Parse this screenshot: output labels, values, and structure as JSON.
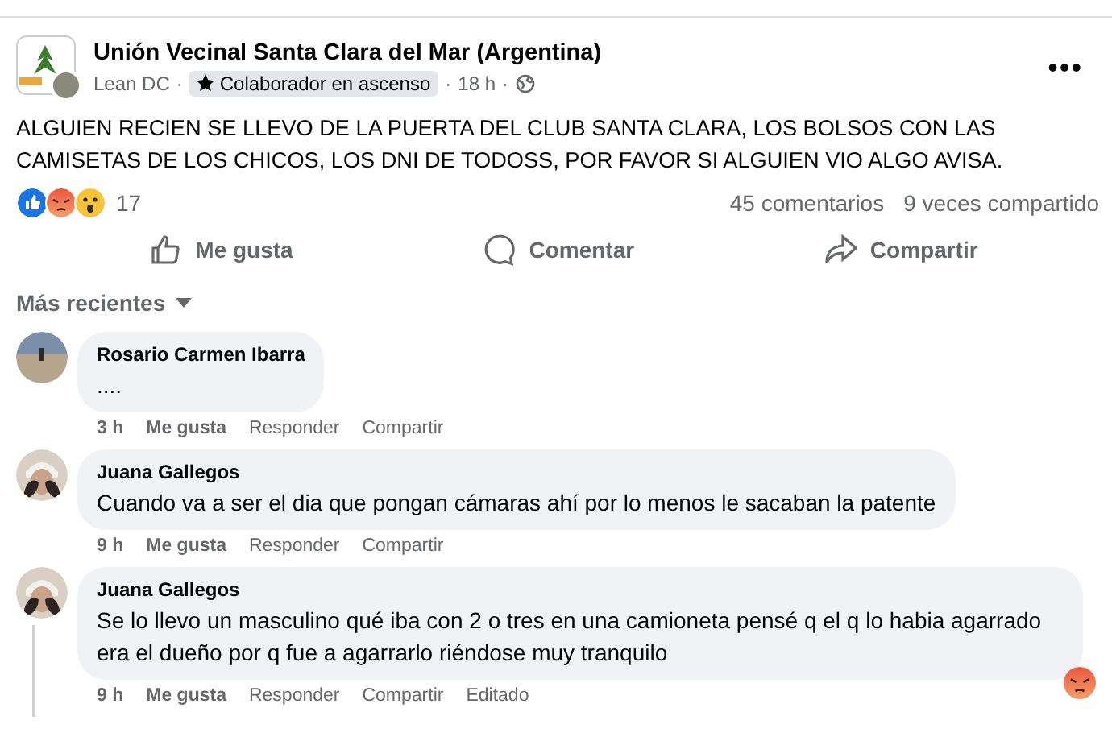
{
  "post": {
    "group": "Unión Vecinal Santa Clara del Mar (Argentina)",
    "author": "Lean DC",
    "separator": "·",
    "more": "•••",
    "badge": "Colaborador en ascenso",
    "time": "18 h",
    "text": "ALGUIEN RECIEN SE LLEVO DE LA PUERTA DEL CLUB SANTA CLARA, LOS BOLSOS CON LAS CAMISETAS DE LOS CHICOS, LOS DNI DE TODOSS, POR FAVOR SI ALGUIEN VIO ALGO AVISA.",
    "reactions": [
      {
        "kind": "like"
      },
      {
        "kind": "angry"
      },
      {
        "kind": "wow"
      }
    ],
    "reaction_count": "17",
    "comments_count": "45 comentarios",
    "shares": "9 veces compartido",
    "actions": [
      {
        "kind": "like",
        "label": "Me gusta"
      },
      {
        "kind": "comment",
        "label": "Comentar"
      },
      {
        "kind": "share",
        "label": "Compartir"
      }
    ]
  },
  "sort": "Más recientes",
  "comments": [
    {
      "name": "Rosario Carmen Ibarra",
      "text": "....",
      "time": "3 h",
      "actions": [
        "Me gusta",
        "Responder",
        "Compartir"
      ],
      "thread": false
    },
    {
      "name": "Juana Gallegos",
      "text": "Cuando va a ser el dia que pongan cámaras ahí por lo menos le sacaban la patente",
      "time": "9 h",
      "actions": [
        "Me gusta",
        "Responder",
        "Compartir"
      ],
      "thread": false
    },
    {
      "name": "Juana Gallegos",
      "text": "Se lo llevo un masculino qué iba con 2 o tres en una camioneta pensé q el q lo habia agarrado era el dueño por q fue a agarrarlo riéndose muy tranquilo",
      "time": "9 h",
      "actions": [
        "Me gusta",
        "Responder",
        "Compartir"
      ],
      "edited": "Editado",
      "reaction": {
        "kind": "angry"
      },
      "thread": true
    }
  ]
}
